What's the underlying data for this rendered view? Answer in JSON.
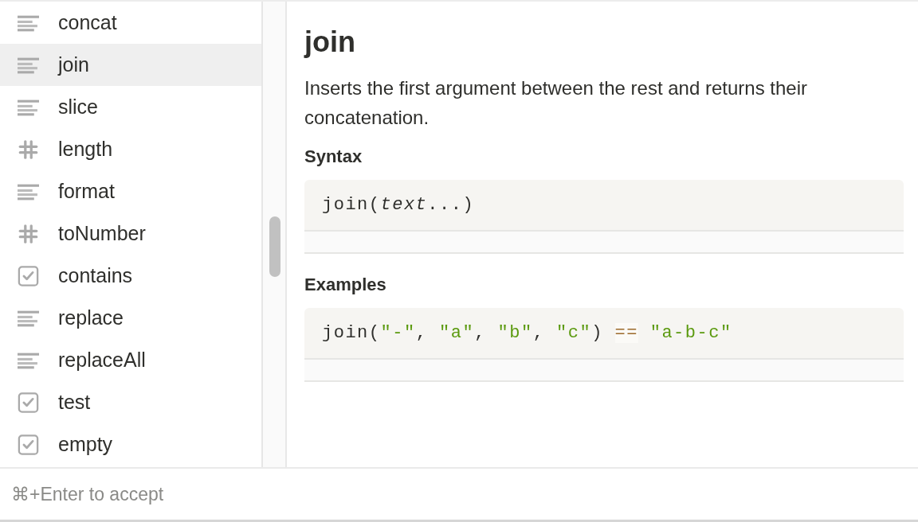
{
  "sidebar": {
    "items": [
      {
        "label": "concat",
        "kind": "text",
        "selected": false
      },
      {
        "label": "join",
        "kind": "text",
        "selected": true
      },
      {
        "label": "slice",
        "kind": "text",
        "selected": false
      },
      {
        "label": "length",
        "kind": "number",
        "selected": false
      },
      {
        "label": "format",
        "kind": "text",
        "selected": false
      },
      {
        "label": "toNumber",
        "kind": "number",
        "selected": false
      },
      {
        "label": "contains",
        "kind": "checkbox",
        "selected": false
      },
      {
        "label": "replace",
        "kind": "text",
        "selected": false
      },
      {
        "label": "replaceAll",
        "kind": "text",
        "selected": false
      },
      {
        "label": "test",
        "kind": "checkbox",
        "selected": false
      },
      {
        "label": "empty",
        "kind": "checkbox",
        "selected": false
      }
    ]
  },
  "detail": {
    "title": "join",
    "description": "Inserts the first argument between the rest and returns their concatenation.",
    "sections": [
      {
        "heading": "Syntax",
        "code": [
          {
            "kind": "plain",
            "text": "join("
          },
          {
            "kind": "italic",
            "text": "text"
          },
          {
            "kind": "plain",
            "text": "...)"
          }
        ]
      },
      {
        "heading": "Examples",
        "code": [
          {
            "kind": "plain",
            "text": "join("
          },
          {
            "kind": "string",
            "text": "\"-\""
          },
          {
            "kind": "plain",
            "text": ", "
          },
          {
            "kind": "string",
            "text": "\"a\""
          },
          {
            "kind": "plain",
            "text": ", "
          },
          {
            "kind": "string",
            "text": "\"b\""
          },
          {
            "kind": "plain",
            "text": ", "
          },
          {
            "kind": "string",
            "text": "\"c\""
          },
          {
            "kind": "plain",
            "text": ") "
          },
          {
            "kind": "operator",
            "text": "=="
          },
          {
            "kind": "string",
            "text": " \"a-b-c\""
          }
        ]
      }
    ]
  },
  "footer": {
    "hint": "⌘+Enter to accept"
  }
}
